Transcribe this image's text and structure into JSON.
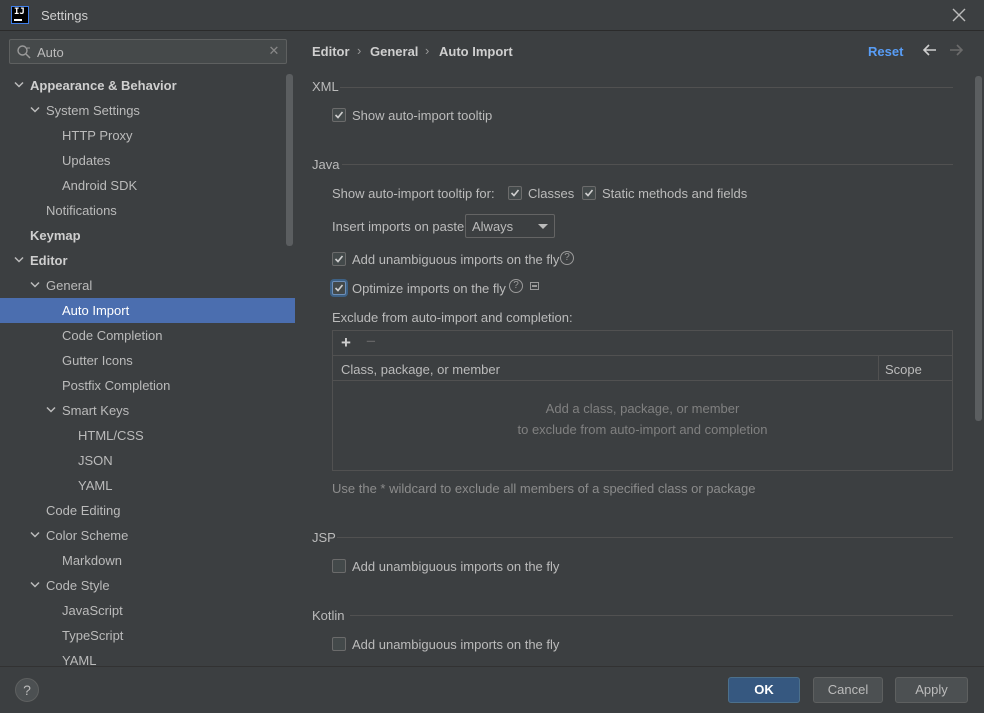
{
  "window": {
    "title": "Settings",
    "icon": "intellij-icon"
  },
  "search": {
    "value": "Auto",
    "placeholder": ""
  },
  "tree": [
    {
      "label": "Appearance & Behavior",
      "level": 0,
      "expanded": true,
      "bold": true
    },
    {
      "label": "System Settings",
      "level": 1,
      "expanded": true
    },
    {
      "label": "HTTP Proxy",
      "level": 2
    },
    {
      "label": "Updates",
      "level": 2
    },
    {
      "label": "Android SDK",
      "level": 2
    },
    {
      "label": "Notifications",
      "level": 1
    },
    {
      "label": "Keymap",
      "level": 0,
      "bold": true
    },
    {
      "label": "Editor",
      "level": 0,
      "expanded": true,
      "bold": true
    },
    {
      "label": "General",
      "level": 1,
      "expanded": true
    },
    {
      "label": "Auto Import",
      "level": 2,
      "selected": true
    },
    {
      "label": "Code Completion",
      "level": 2
    },
    {
      "label": "Gutter Icons",
      "level": 2
    },
    {
      "label": "Postfix Completion",
      "level": 2
    },
    {
      "label": "Smart Keys",
      "level": 2,
      "expanded": true
    },
    {
      "label": "HTML/CSS",
      "level": 3
    },
    {
      "label": "JSON",
      "level": 3
    },
    {
      "label": "YAML",
      "level": 3
    },
    {
      "label": "Code Editing",
      "level": 1
    },
    {
      "label": "Color Scheme",
      "level": 1,
      "expanded": true
    },
    {
      "label": "Markdown",
      "level": 2
    },
    {
      "label": "Code Style",
      "level": 1,
      "expanded": true
    },
    {
      "label": "JavaScript",
      "level": 2
    },
    {
      "label": "TypeScript",
      "level": 2
    },
    {
      "label": "YAML",
      "level": 2
    }
  ],
  "breadcrumb": [
    "Editor",
    "General",
    "Auto Import"
  ],
  "header": {
    "reset_label": "Reset"
  },
  "xml": {
    "title": "XML",
    "show_tooltip": {
      "label": "Show auto-import tooltip",
      "checked": true
    }
  },
  "java": {
    "title": "Java",
    "tooltip_for_label": "Show auto-import tooltip for:",
    "classes": {
      "label": "Classes",
      "checked": true
    },
    "static_methods": {
      "label": "Static methods and fields",
      "checked": true
    },
    "insert_on_paste_label": "Insert imports on paste:",
    "insert_on_paste_value": "Always",
    "add_unambiguous": {
      "label": "Add unambiguous imports on the fly",
      "checked": true
    },
    "optimize": {
      "label": "Optimize imports on the fly",
      "checked": true
    },
    "exclude_label": "Exclude from auto-import and completion:",
    "table": {
      "columns": [
        "Class, package, or member",
        "Scope"
      ],
      "empty_line1": "Add a class, package, or member",
      "empty_line2": "to exclude from auto-import and completion",
      "add_symbol": "+",
      "remove_symbol": "−"
    },
    "hint": "Use the * wildcard to exclude all members of a specified class or package"
  },
  "jsp": {
    "title": "JSP",
    "add_unambiguous": {
      "label": "Add unambiguous imports on the fly",
      "checked": false
    }
  },
  "kotlin": {
    "title": "Kotlin",
    "add_unambiguous": {
      "label": "Add unambiguous imports on the fly",
      "checked": false
    }
  },
  "footer": {
    "ok_label": "OK",
    "cancel_label": "Cancel",
    "apply_label": "Apply",
    "help_symbol": "?"
  },
  "colors": {
    "accent": "#589df6",
    "selection": "#4b6eaf",
    "primary_button": "#365880",
    "background": "#3c3f41"
  }
}
